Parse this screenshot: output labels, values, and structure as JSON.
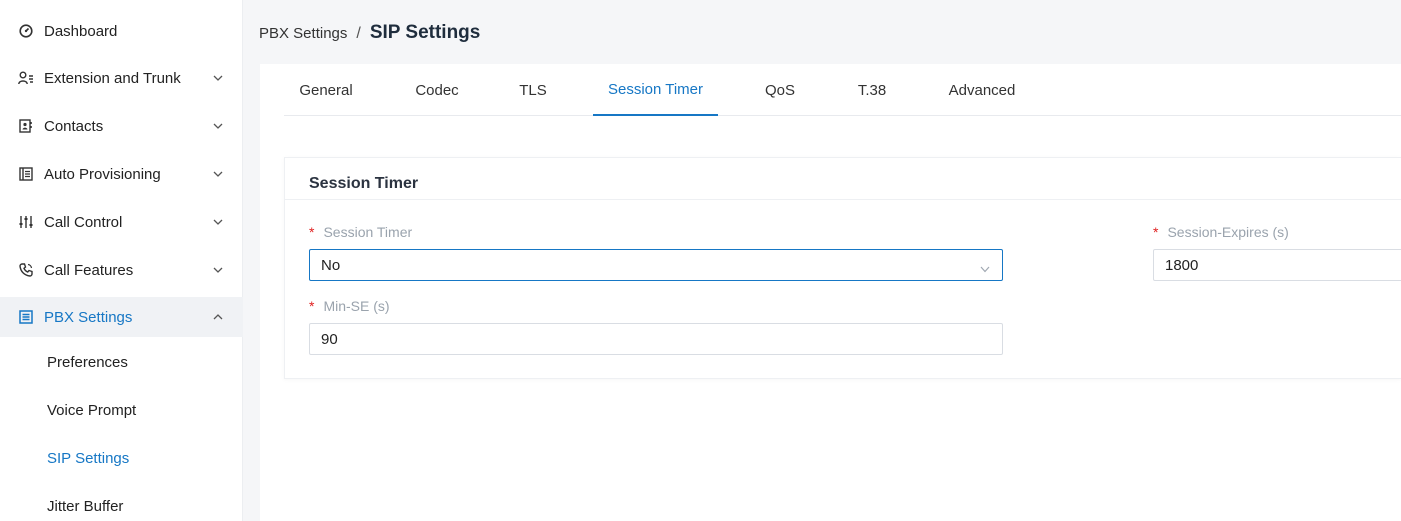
{
  "sidebar": {
    "items": [
      {
        "label": "Dashboard",
        "icon": "dashboard-icon",
        "expandable": false
      },
      {
        "label": "Extension and Trunk",
        "icon": "user-list-icon",
        "expandable": true
      },
      {
        "label": "Contacts",
        "icon": "contacts-book-icon",
        "expandable": true
      },
      {
        "label": "Auto Provisioning",
        "icon": "provisioning-icon",
        "expandable": true
      },
      {
        "label": "Call Control",
        "icon": "sliders-icon",
        "expandable": true
      },
      {
        "label": "Call Features",
        "icon": "phone-icon",
        "expandable": true
      },
      {
        "label": "PBX Settings",
        "icon": "settings-list-icon",
        "expandable": true,
        "expanded": true
      }
    ],
    "subitems": [
      {
        "label": "Preferences"
      },
      {
        "label": "Voice Prompt"
      },
      {
        "label": "SIP Settings",
        "active": true
      },
      {
        "label": "Jitter Buffer"
      }
    ]
  },
  "breadcrumb": {
    "parent": "PBX Settings",
    "separator": "/",
    "current": "SIP Settings"
  },
  "tabs": [
    {
      "label": "General"
    },
    {
      "label": "Codec"
    },
    {
      "label": "TLS"
    },
    {
      "label": "Session Timer",
      "active": true
    },
    {
      "label": "QoS"
    },
    {
      "label": "T.38"
    },
    {
      "label": "Advanced"
    }
  ],
  "card": {
    "title": "Session Timer",
    "fields": {
      "session_timer": {
        "label": "Session Timer",
        "required_mark": "*",
        "value": "No"
      },
      "session_expires": {
        "label": "Session-Expires (s)",
        "required_mark": "*",
        "value": "1800"
      },
      "min_se": {
        "label": "Min-SE (s)",
        "required_mark": "*",
        "value": "90"
      }
    }
  },
  "colors": {
    "accent": "#1677c5",
    "required": "#e02020",
    "label": "#9aa3ad"
  }
}
